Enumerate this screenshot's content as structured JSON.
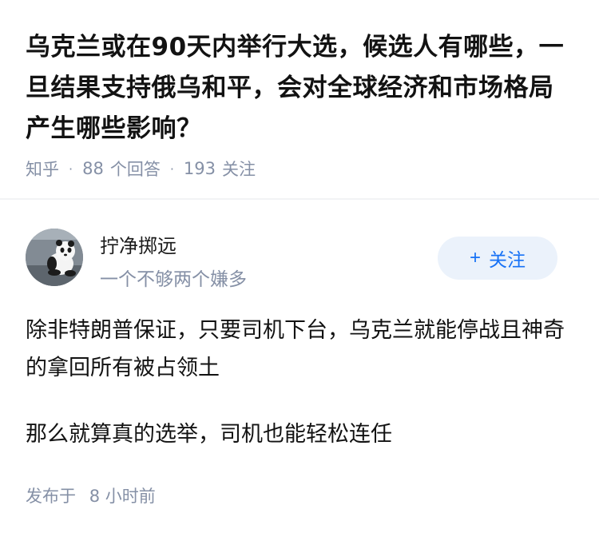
{
  "question": {
    "title": "乌克兰或在90天内举行大选，候选人有哪些，一旦结果支持俄乌和平，会对全球经济和市场格局产生哪些影响？",
    "source": "知乎",
    "answer_count": "88",
    "answer_label": "个回答",
    "follow_count": "193",
    "follow_label": "关注",
    "separator": "·"
  },
  "answer": {
    "author": {
      "name": "拧净掷远",
      "bio": "一个不够两个嫌多",
      "avatar_icon": "panda-avatar"
    },
    "follow_button": {
      "icon": "+",
      "label": "关注"
    },
    "paragraphs": [
      "除非特朗普保证，只要司机下台，乌克兰就能停战且神奇的拿回所有被占领土",
      "那么就算真的选举，司机也能轻松连任"
    ],
    "published_prefix": "发布于",
    "published_time": "8 小时前"
  },
  "colors": {
    "accent": "#1772f6",
    "follow_bg": "#ebf2fb",
    "meta_gray": "#8590a6",
    "text": "#121212",
    "divider": "#f2f3f5"
  }
}
